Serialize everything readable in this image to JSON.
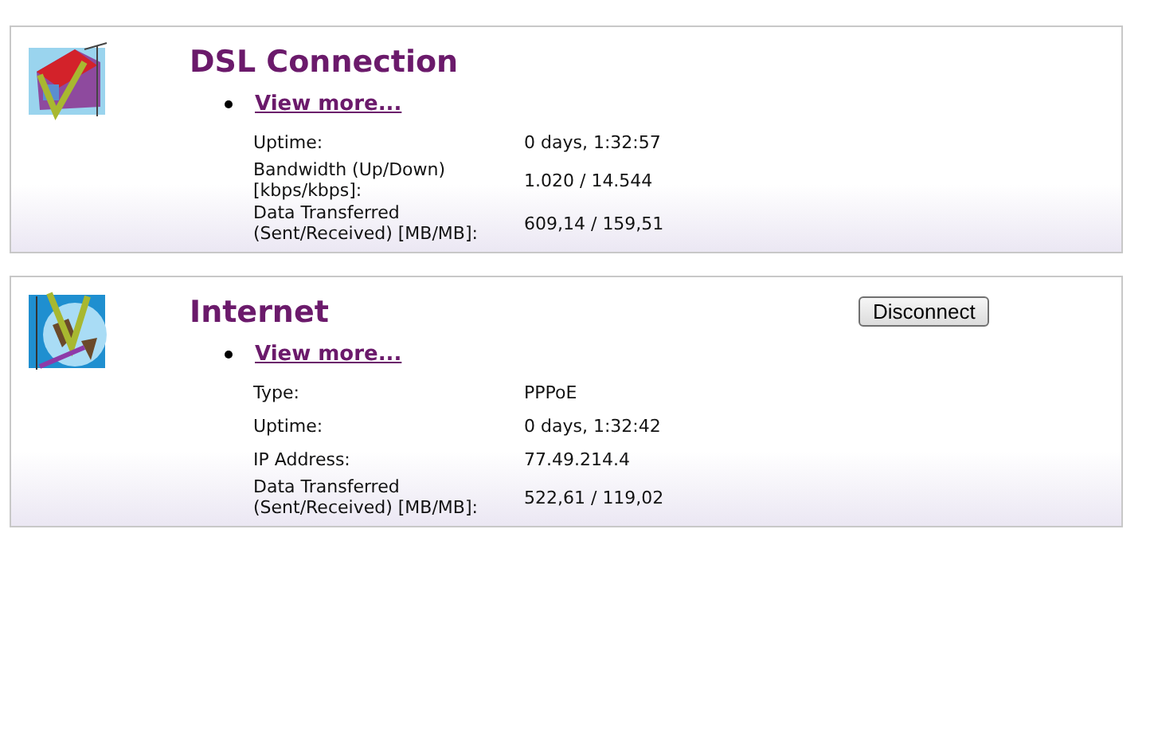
{
  "panels": [
    {
      "kind": "dsl",
      "title": "DSL Connection",
      "link": "View more...",
      "rows": [
        {
          "label": "Uptime:",
          "value": "0 days, 1:32:57"
        },
        {
          "label": "Bandwidth (Up/Down)\n[kbps/kbps]:",
          "value": "1.020 / 14.544"
        },
        {
          "label": "Data Transferred\n(Sent/Received) [MB/MB]:",
          "value": "609,14 / 159,51"
        }
      ]
    },
    {
      "kind": "internet",
      "title": "Internet",
      "link": "View more...",
      "button": "Disconnect",
      "rows": [
        {
          "label": "Type:",
          "value": "PPPoE"
        },
        {
          "label": "Uptime:",
          "value": "0 days, 1:32:42"
        },
        {
          "label": "IP Address:",
          "value": "77.49.214.4"
        },
        {
          "label": "Data Transferred\n(Sent/Received) [MB/MB]:",
          "value": "522,61 / 119,02"
        }
      ]
    }
  ]
}
